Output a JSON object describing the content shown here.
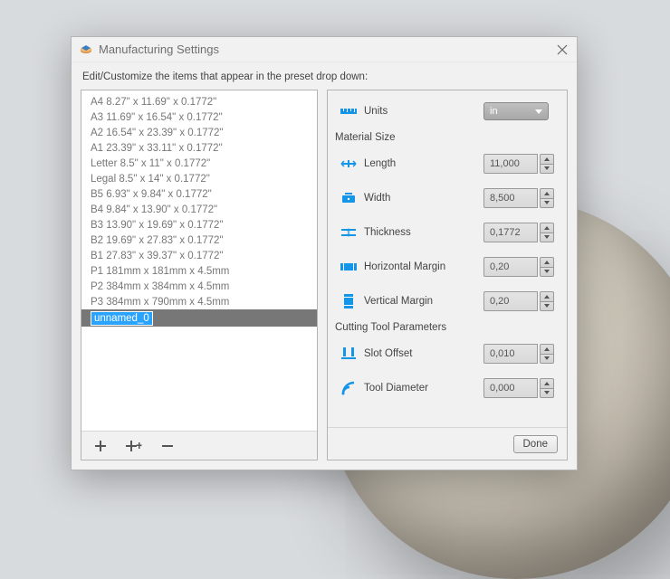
{
  "window": {
    "title": "Manufacturing Settings"
  },
  "instruction": "Edit/Customize the items that appear in the preset drop down:",
  "presets": [
    "A4 8.27\" x 11.69\" x 0.1772\"",
    "A3 11.69\" x 16.54\" x 0.1772\"",
    "A2 16.54\" x 23.39\" x 0.1772\"",
    "A1 23.39\" x 33.11\" x 0.1772\"",
    "Letter 8.5\" x 11\" x 0.1772\"",
    "Legal 8.5\" x 14\" x 0.1772\"",
    "B5 6.93\" x 9.84\" x 0.1772\"",
    "B4 9.84\" x 13.90\" x 0.1772\"",
    "B3 13.90\" x 19.69\" x 0.1772\"",
    "B2 19.69\" x 27.83\" x 0.1772\"",
    "B1 27.83\" x 39.37\" x 0.1772\"",
    "P1 181mm x 181mm x 4.5mm",
    "P2 384mm x 384mm x 4.5mm",
    "P3 384mm x 790mm x 4.5mm"
  ],
  "editing_preset": "unnamed_0",
  "props": {
    "units": {
      "label": "Units",
      "value": "in"
    },
    "material_header": "Material Size",
    "length": {
      "label": "Length",
      "value": "11,000"
    },
    "width": {
      "label": "Width",
      "value": "8,500"
    },
    "thickness": {
      "label": "Thickness",
      "value": "0,1772"
    },
    "hmargin": {
      "label": "Horizontal Margin",
      "value": "0,20"
    },
    "vmargin": {
      "label": "Vertical Margin",
      "value": "0,20"
    },
    "cutting_header": "Cutting Tool Parameters",
    "slot_offset": {
      "label": "Slot Offset",
      "value": "0,010"
    },
    "tool_diameter": {
      "label": "Tool Diameter",
      "value": "0,000"
    }
  },
  "buttons": {
    "done": "Done"
  }
}
